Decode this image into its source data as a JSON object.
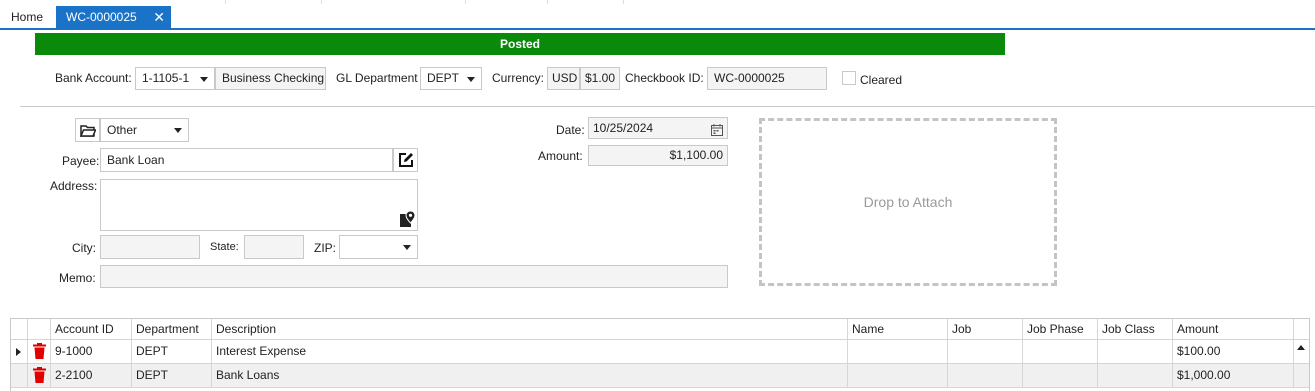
{
  "tabs": {
    "home": "Home",
    "active": "WC-0000025"
  },
  "status": "Posted",
  "header": {
    "bank_account_label": "Bank Account:",
    "bank_account_value": "1-1105-1",
    "bank_account_name": "Business Checking",
    "gl_department_label": "GL Department",
    "gl_department_value": "DEPT",
    "currency_label": "Currency:",
    "currency_code": "USD",
    "currency_symbol": "$1.00",
    "checkbook_id_label": "Checkbook ID:",
    "checkbook_id_value": "WC-0000025",
    "cleared_label": "Cleared"
  },
  "form": {
    "payee_type": "Other",
    "payee_label": "Payee:",
    "payee_value": "Bank Loan",
    "address_label": "Address:",
    "address_value": "",
    "city_label": "City:",
    "city_value": "",
    "state_label": "State:",
    "state_value": "",
    "zip_label": "ZIP:",
    "zip_value": "",
    "memo_label": "Memo:",
    "memo_value": "",
    "date_label": "Date:",
    "date_value": "10/25/2024",
    "amount_label": "Amount:",
    "amount_value": "$1,100.00"
  },
  "drop_zone": "Drop to Attach",
  "grid": {
    "columns": {
      "account_id": "Account ID",
      "department": "Department",
      "description": "Description",
      "name": "Name",
      "job": "Job",
      "job_phase": "Job Phase",
      "job_class": "Job Class",
      "amount": "Amount"
    },
    "rows": [
      {
        "account_id": "9-1000",
        "department": "DEPT",
        "description": "Interest Expense",
        "name": "",
        "job": "",
        "job_phase": "",
        "job_class": "",
        "amount": "$100.00"
      },
      {
        "account_id": "2-2100",
        "department": "DEPT",
        "description": "Bank Loans",
        "name": "",
        "job": "",
        "job_phase": "",
        "job_class": "",
        "amount": "$1,000.00"
      }
    ]
  },
  "colors": {
    "accent": "#1a73c7",
    "status_posted": "#0a8a0a",
    "delete_icon": "#e00000"
  },
  "icons": [
    "folder-icon",
    "edit-icon",
    "map-pin-icon",
    "calendar-icon",
    "delete-icon",
    "row-indicator-icon",
    "scroll-up-icon",
    "close-icon",
    "dropdown-arrow-icon"
  ]
}
